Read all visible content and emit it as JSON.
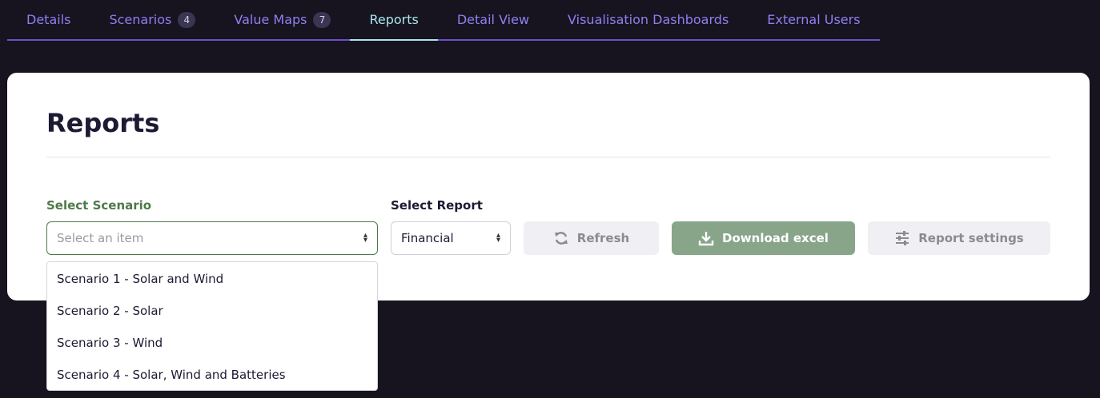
{
  "tabs": [
    {
      "label": "Details",
      "badge": null
    },
    {
      "label": "Scenarios",
      "badge": "4"
    },
    {
      "label": "Value Maps",
      "badge": "7"
    },
    {
      "label": "Reports",
      "badge": null
    },
    {
      "label": "Detail View",
      "badge": null
    },
    {
      "label": "Visualisation Dashboards",
      "badge": null
    },
    {
      "label": "External Users",
      "badge": null
    }
  ],
  "active_tab": "Reports",
  "page": {
    "title": "Reports",
    "scenario_label": "Select Scenario",
    "scenario_placeholder": "Select an item",
    "report_label": "Select Report",
    "report_value": "Financial",
    "refresh_label": "Refresh",
    "download_label": "Download excel",
    "settings_label": "Report settings"
  },
  "dropdown": {
    "options": [
      "Scenario 1 - Solar and Wind",
      "Scenario 2 - Solar",
      "Scenario 3 - Wind",
      "Scenario 4 - Solar, Wind and Batteries"
    ]
  },
  "colors": {
    "background": "#17131f",
    "tab_text": "#8e80f0",
    "tab_active": "#a7e6ee",
    "accent_green": "#4d7a48",
    "download_bg": "#88a58a"
  }
}
